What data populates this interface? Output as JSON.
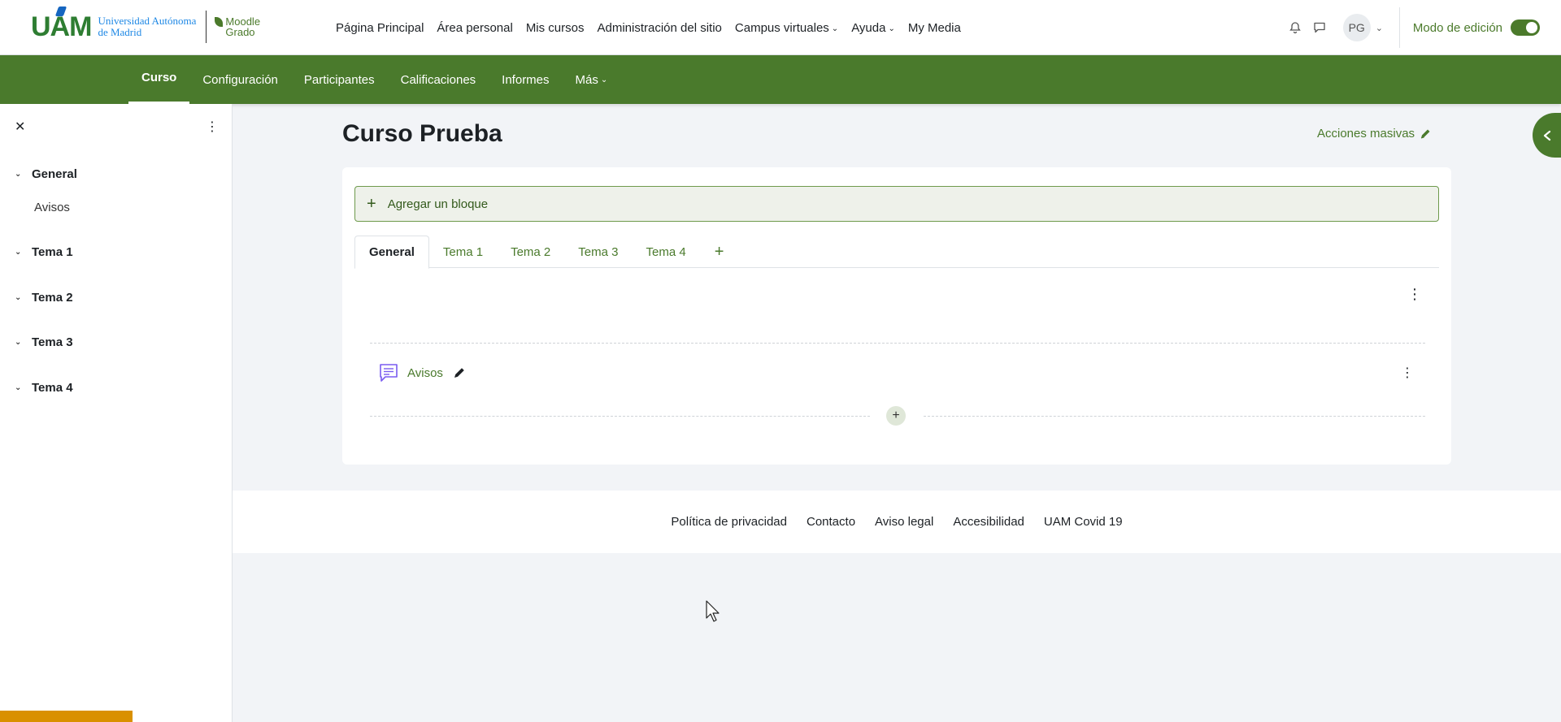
{
  "header": {
    "logo": {
      "brand": "UAM",
      "university_line1": "Universidad Autónoma",
      "university_line2": "de Madrid",
      "moodle_line1": "Moodle",
      "moodle_line2": "Grado"
    },
    "nav": [
      {
        "label": "Página Principal",
        "has_dropdown": false
      },
      {
        "label": "Área personal",
        "has_dropdown": false
      },
      {
        "label": "Mis cursos",
        "has_dropdown": false
      },
      {
        "label": "Administración del sitio",
        "has_dropdown": false
      },
      {
        "label": "Campus virtuales",
        "has_dropdown": true
      },
      {
        "label": "Ayuda",
        "has_dropdown": true
      },
      {
        "label": "My Media",
        "has_dropdown": false
      }
    ],
    "icons": {
      "notifications": "bell-icon",
      "messages": "chat-icon"
    },
    "user_initials": "PG",
    "edit_mode_label": "Modo de edición",
    "edit_mode_on": true
  },
  "secondary_nav": {
    "items": [
      {
        "label": "Curso",
        "active": true
      },
      {
        "label": "Configuración",
        "active": false
      },
      {
        "label": "Participantes",
        "active": false
      },
      {
        "label": "Calificaciones",
        "active": false
      },
      {
        "label": "Informes",
        "active": false
      },
      {
        "label": "Más",
        "active": false,
        "has_dropdown": true
      }
    ]
  },
  "course_index": {
    "sections": [
      {
        "label": "General",
        "activities": [
          "Avisos"
        ]
      },
      {
        "label": "Tema 1",
        "activities": []
      },
      {
        "label": "Tema 2",
        "activities": []
      },
      {
        "label": "Tema 3",
        "activities": []
      },
      {
        "label": "Tema 4",
        "activities": []
      }
    ]
  },
  "main": {
    "title": "Curso Prueba",
    "bulk_actions_label": "Acciones masivas",
    "add_block_label": "Agregar un bloque",
    "tabs": [
      {
        "label": "General",
        "active": true
      },
      {
        "label": "Tema 1",
        "active": false
      },
      {
        "label": "Tema 2",
        "active": false
      },
      {
        "label": "Tema 3",
        "active": false
      },
      {
        "label": "Tema 4",
        "active": false
      }
    ],
    "activity": {
      "name": "Avisos",
      "icon": "forum-icon"
    }
  },
  "footer": {
    "links": [
      "Política de privacidad",
      "Contacto",
      "Aviso legal",
      "Accesibilidad",
      "UAM Covid 19"
    ]
  },
  "colors": {
    "brand_green": "#4a7a2c",
    "add_block_bg": "#eef1ea",
    "page_bg": "#f2f4f7",
    "orange_bar": "#d99000",
    "forum_icon": "#7a5cf0"
  }
}
